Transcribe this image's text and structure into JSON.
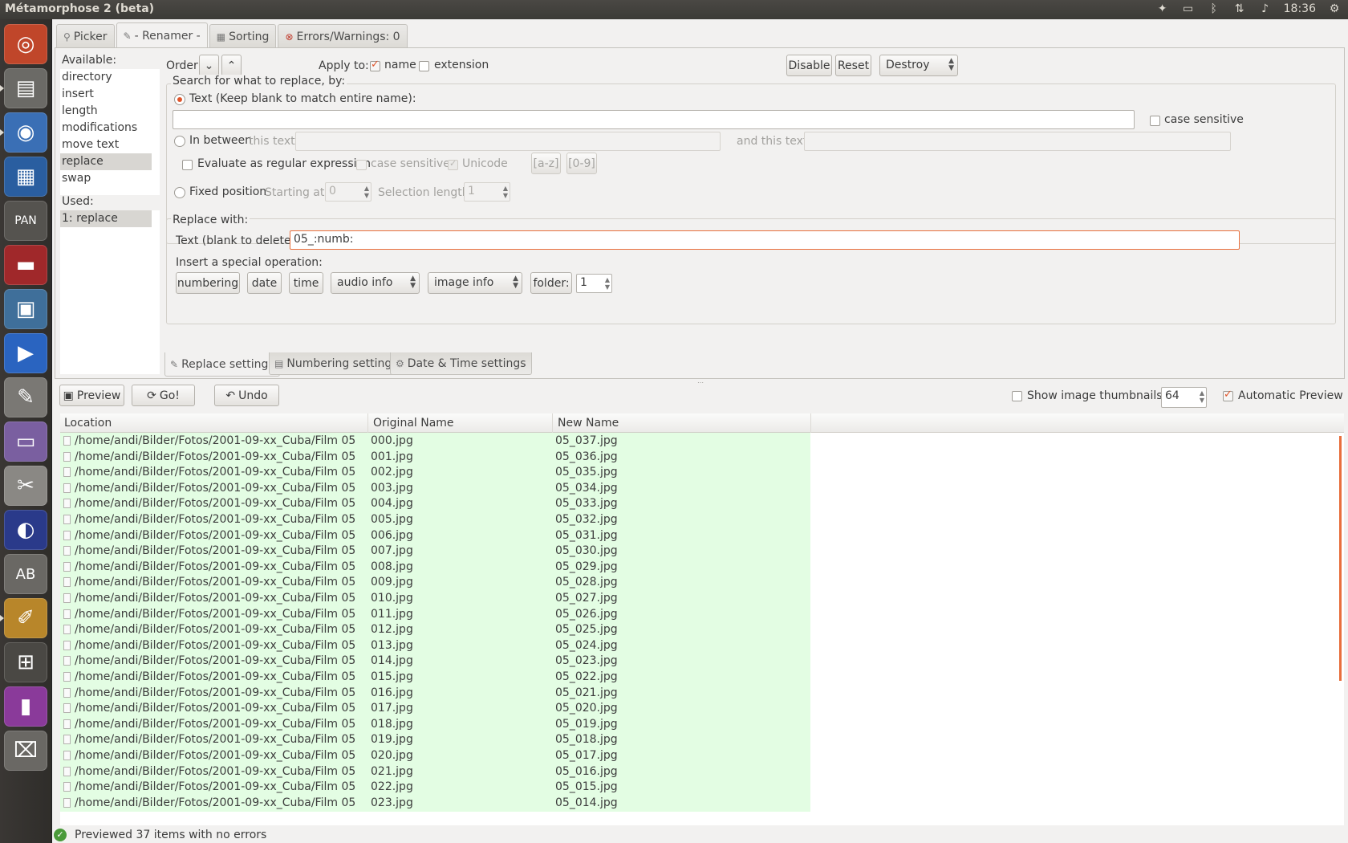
{
  "window_title": "Métamorphose 2 (beta)",
  "clock": "18:36",
  "tray_icons": [
    "dropbox-icon",
    "battery-icon",
    "bluetooth-icon",
    "network-icon",
    "volume-icon",
    "settings-gear-icon"
  ],
  "launcher_icons": [
    "ubuntu-dash-icon",
    "files-icon",
    "chrome-icon",
    "writer-icon",
    "pan-icon",
    "media-app-icon",
    "image-viewer-icon",
    "media-player-icon",
    "text-editor-icon",
    "remote-desktop-icon",
    "system-tools-icon",
    "eclipse-icon",
    "font-viewer-icon",
    "archive-tools-icon",
    "workspace-switcher-icon",
    "app-icon",
    "trash-icon"
  ],
  "tabs": {
    "picker": "Picker",
    "renamer": "- Renamer -",
    "sorting": "Sorting",
    "errors": "Errors/Warnings: 0"
  },
  "available": {
    "header": "Available:",
    "items": [
      "directory",
      "insert",
      "length",
      "modifications",
      "move text",
      "replace",
      "swap"
    ],
    "selected_index": 5,
    "used_header": "Used:",
    "used_items": [
      "1: replace"
    ]
  },
  "top_row": {
    "order_label": "Order:",
    "apply_to_label": "Apply to:",
    "name_label": "name",
    "extension_label": "extension",
    "disable": "Disable",
    "reset": "Reset",
    "destroy": "Destroy"
  },
  "search": {
    "frame_label": "Search for what to replace, by:",
    "text_option": "Text (Keep blank to match entire name):",
    "text_value": "",
    "case_sensitive": "case sensitive",
    "in_between": "In between",
    "this_text": "this text:",
    "and_this_text": "and this text:",
    "regex": "Evaluate as regular expression",
    "regex_case": "case sensitive",
    "unicode": "Unicode",
    "az": "[a-z]",
    "nine": "[0-9]",
    "fixed_position": "Fixed position",
    "starting_at": "Starting at:",
    "starting_value": "0",
    "selection_length": "Selection length:",
    "selection_value": "1"
  },
  "replace": {
    "frame_label": "Replace with:",
    "text_label": "Text (blank to delete):",
    "text_value": "05_:numb:",
    "special_label": "Insert a special operation:",
    "numbering": "numbering",
    "date": "date",
    "time": "time",
    "audio_info": "audio info",
    "image_info": "image info",
    "folder_label": "folder:",
    "folder_value": "1"
  },
  "bottom_tabs": {
    "replace_settings": "Replace settings",
    "numbering_settings": "Numbering settings",
    "datetime_settings": "Date & Time settings"
  },
  "actions": {
    "preview": "Preview",
    "go": "Go!",
    "undo": "Undo",
    "show_thumbs": "Show image thumbnails",
    "thumb_size": "64",
    "auto_preview": "Automatic Preview"
  },
  "table": {
    "headers": [
      "Location",
      "Original Name",
      "New Name"
    ],
    "rows": [
      [
        "/home/andi/Bilder/Fotos/2001-09-xx_Cuba/Film 05",
        "000.jpg",
        "05_037.jpg"
      ],
      [
        "/home/andi/Bilder/Fotos/2001-09-xx_Cuba/Film 05",
        "001.jpg",
        "05_036.jpg"
      ],
      [
        "/home/andi/Bilder/Fotos/2001-09-xx_Cuba/Film 05",
        "002.jpg",
        "05_035.jpg"
      ],
      [
        "/home/andi/Bilder/Fotos/2001-09-xx_Cuba/Film 05",
        "003.jpg",
        "05_034.jpg"
      ],
      [
        "/home/andi/Bilder/Fotos/2001-09-xx_Cuba/Film 05",
        "004.jpg",
        "05_033.jpg"
      ],
      [
        "/home/andi/Bilder/Fotos/2001-09-xx_Cuba/Film 05",
        "005.jpg",
        "05_032.jpg"
      ],
      [
        "/home/andi/Bilder/Fotos/2001-09-xx_Cuba/Film 05",
        "006.jpg",
        "05_031.jpg"
      ],
      [
        "/home/andi/Bilder/Fotos/2001-09-xx_Cuba/Film 05",
        "007.jpg",
        "05_030.jpg"
      ],
      [
        "/home/andi/Bilder/Fotos/2001-09-xx_Cuba/Film 05",
        "008.jpg",
        "05_029.jpg"
      ],
      [
        "/home/andi/Bilder/Fotos/2001-09-xx_Cuba/Film 05",
        "009.jpg",
        "05_028.jpg"
      ],
      [
        "/home/andi/Bilder/Fotos/2001-09-xx_Cuba/Film 05",
        "010.jpg",
        "05_027.jpg"
      ],
      [
        "/home/andi/Bilder/Fotos/2001-09-xx_Cuba/Film 05",
        "011.jpg",
        "05_026.jpg"
      ],
      [
        "/home/andi/Bilder/Fotos/2001-09-xx_Cuba/Film 05",
        "012.jpg",
        "05_025.jpg"
      ],
      [
        "/home/andi/Bilder/Fotos/2001-09-xx_Cuba/Film 05",
        "013.jpg",
        "05_024.jpg"
      ],
      [
        "/home/andi/Bilder/Fotos/2001-09-xx_Cuba/Film 05",
        "014.jpg",
        "05_023.jpg"
      ],
      [
        "/home/andi/Bilder/Fotos/2001-09-xx_Cuba/Film 05",
        "015.jpg",
        "05_022.jpg"
      ],
      [
        "/home/andi/Bilder/Fotos/2001-09-xx_Cuba/Film 05",
        "016.jpg",
        "05_021.jpg"
      ],
      [
        "/home/andi/Bilder/Fotos/2001-09-xx_Cuba/Film 05",
        "017.jpg",
        "05_020.jpg"
      ],
      [
        "/home/andi/Bilder/Fotos/2001-09-xx_Cuba/Film 05",
        "018.jpg",
        "05_019.jpg"
      ],
      [
        "/home/andi/Bilder/Fotos/2001-09-xx_Cuba/Film 05",
        "019.jpg",
        "05_018.jpg"
      ],
      [
        "/home/andi/Bilder/Fotos/2001-09-xx_Cuba/Film 05",
        "020.jpg",
        "05_017.jpg"
      ],
      [
        "/home/andi/Bilder/Fotos/2001-09-xx_Cuba/Film 05",
        "021.jpg",
        "05_016.jpg"
      ],
      [
        "/home/andi/Bilder/Fotos/2001-09-xx_Cuba/Film 05",
        "022.jpg",
        "05_015.jpg"
      ],
      [
        "/home/andi/Bilder/Fotos/2001-09-xx_Cuba/Film 05",
        "023.jpg",
        "05_014.jpg"
      ]
    ]
  },
  "status": "Previewed 37 items with no errors",
  "colors": {
    "accent": "#e0552b",
    "preview_row": "#e3fde3",
    "launcher_bg": "#2f2d2a"
  }
}
